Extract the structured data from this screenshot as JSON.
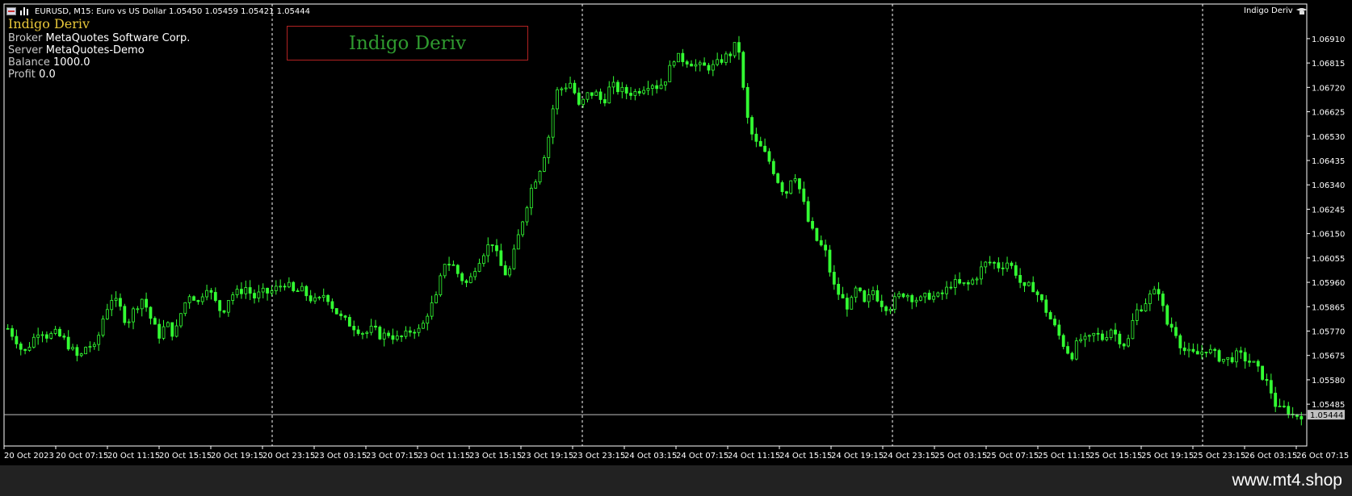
{
  "title_bar": {
    "text": "EURUSD, M15:  Euro vs US Dollar  1.05450 1.05459 1.05421 1.05444",
    "icons": [
      "flag-icon",
      "bar-chart-icon"
    ]
  },
  "overlay": {
    "ea_name": "Indigo Deriv",
    "info": [
      {
        "key": "Broker",
        "value": "MetaQuotes Software Corp."
      },
      {
        "key": "Server",
        "value": "MetaQuotes-Demo"
      },
      {
        "key": "Balance",
        "value": "1000.0"
      },
      {
        "key": "Profit",
        "value": "0.0"
      }
    ],
    "watermark": "Indigo Deriv",
    "top_right_label": "Indigo Deriv",
    "top_right_icon": "graduation-cap-icon"
  },
  "footer": {
    "site": "www.mt4.shop"
  },
  "colors": {
    "background": "#000000",
    "candle": "#33ff33",
    "axis": "#ffffff",
    "grid": "#ffffff",
    "price_line": "#c0c0c0",
    "watermark_border": "#b22222",
    "watermark_text": "#2f9a2f",
    "ea_name": "#e8c73a",
    "current_price_tag": "#c0c0c0"
  },
  "chart_data": {
    "type": "candlestick",
    "symbol": "EURUSD",
    "timeframe": "M15",
    "current_price": 1.05444,
    "current_price_label": "1.05444",
    "ylim": [
      1.0541,
      1.0696
    ],
    "y_ticks": [
      "1.06910",
      "1.06815",
      "1.06720",
      "1.06625",
      "1.06530",
      "1.06435",
      "1.06340",
      "1.06245",
      "1.06150",
      "1.06055",
      "1.05960",
      "1.05865",
      "1.05770",
      "1.05675",
      "1.05580",
      "1.05485"
    ],
    "x_ticks": [
      "20 Oct 2023",
      "20 Oct 07:15",
      "20 Oct 11:15",
      "20 Oct 15:15",
      "20 Oct 19:15",
      "20 Oct 23:15",
      "23 Oct 03:15",
      "23 Oct 07:15",
      "23 Oct 11:15",
      "23 Oct 15:15",
      "23 Oct 19:15",
      "23 Oct 23:15",
      "24 Oct 03:15",
      "24 Oct 07:15",
      "24 Oct 11:15",
      "24 Oct 15:15",
      "24 Oct 19:15",
      "24 Oct 23:15",
      "25 Oct 03:15",
      "25 Oct 07:15",
      "25 Oct 11:15",
      "25 Oct 15:15",
      "25 Oct 19:15",
      "25 Oct 23:15",
      "26 Oct 03:15",
      "26 Oct 07:15"
    ],
    "period_separators_after_tick": [
      "20 Oct 23:15",
      "23 Oct 23:15",
      "24 Oct 23:15",
      "25 Oct 23:15"
    ],
    "grid": false,
    "close_path": [
      1.0578,
      1.0574,
      1.0568,
      1.0573,
      1.0578,
      1.0575,
      1.0576,
      1.0574,
      1.057,
      1.0566,
      1.0572,
      1.057,
      1.0582,
      1.059,
      1.0587,
      1.058,
      1.0586,
      1.059,
      1.0582,
      1.0575,
      1.058,
      1.0575,
      1.0586,
      1.0592,
      1.0588,
      1.0595,
      1.0589,
      1.0584,
      1.0591,
      1.0592,
      1.0594,
      1.059,
      1.0592,
      1.0592,
      1.0594,
      1.0596,
      1.0592,
      1.0593,
      1.059,
      1.0588,
      1.0592,
      1.0586,
      1.0582,
      1.058,
      1.0578,
      1.0576,
      1.0578,
      1.0575,
      1.0576,
      1.0574,
      1.0575,
      1.0578,
      1.0577,
      1.0585,
      1.059,
      1.0604,
      1.0603,
      1.0598,
      1.0595,
      1.0603,
      1.0608,
      1.0612,
      1.0603,
      1.0598,
      1.061,
      1.0622,
      1.0633,
      1.064,
      1.065,
      1.067,
      1.0672,
      1.0674,
      1.0664,
      1.0669,
      1.067,
      1.0666,
      1.0673,
      1.0671,
      1.067,
      1.067,
      1.0672,
      1.0674,
      1.0672,
      1.0676,
      1.0684,
      1.0683,
      1.0682,
      1.068,
      1.068,
      1.068,
      1.0683,
      1.0685,
      1.069,
      1.0662,
      1.0651,
      1.0648,
      1.0643,
      1.0636,
      1.063,
      1.064,
      1.063,
      1.0618,
      1.0612,
      1.0608,
      1.0595,
      1.059,
      1.0586,
      1.0594,
      1.0587,
      1.0593,
      1.0588,
      1.0586,
      1.059,
      1.0592,
      1.059,
      1.0589,
      1.0591,
      1.059,
      1.0592,
      1.0596,
      1.0595,
      1.0595,
      1.0598,
      1.0603,
      1.0604,
      1.0602,
      1.0604,
      1.06,
      1.0593,
      1.0595,
      1.059,
      1.0584,
      1.0578,
      1.0572,
      1.0567,
      1.0574,
      1.0573,
      1.0576,
      1.0574,
      1.0578,
      1.0574,
      1.0571,
      1.0584,
      1.0587,
      1.0591,
      1.0593,
      1.058,
      1.0578,
      1.057,
      1.0568,
      1.0568,
      1.057,
      1.0568,
      1.0566,
      1.0566,
      1.0568,
      1.0566,
      1.0564,
      1.056,
      1.0555,
      1.0546,
      1.0547,
      1.0544,
      1.05444
    ]
  }
}
